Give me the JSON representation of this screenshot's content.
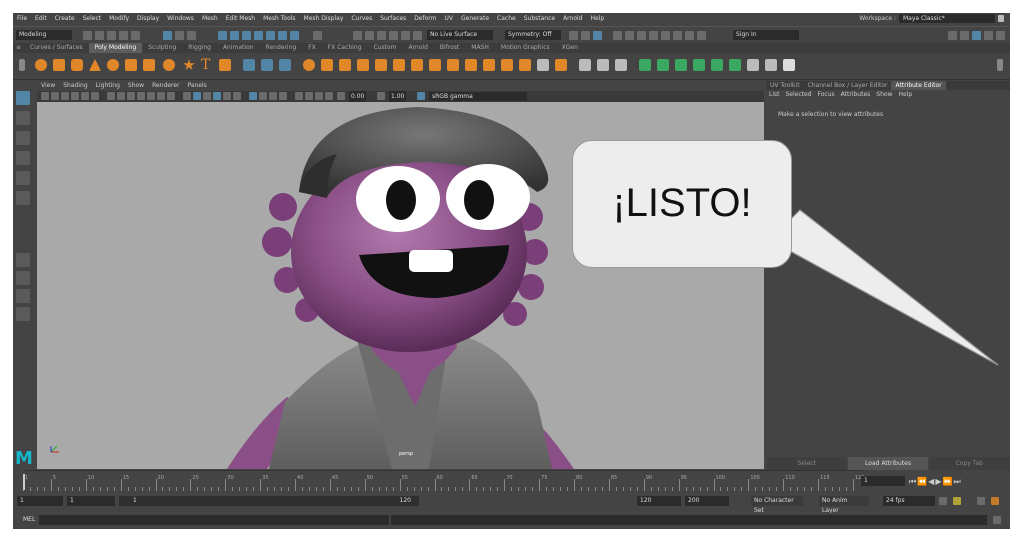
{
  "app": {
    "menu": [
      "File",
      "Edit",
      "Create",
      "Select",
      "Modify",
      "Display",
      "Windows",
      "Mesh",
      "Edit Mesh",
      "Mesh Tools",
      "Mesh Display",
      "Curves",
      "Surfaces",
      "Deform",
      "UV",
      "Generate",
      "Cache",
      "Substance",
      "Arnold",
      "Help"
    ],
    "workspace_label": "Workspace :",
    "workspace_value": "Maya Classic*"
  },
  "statusline": {
    "mode": "Modeling",
    "live_surface": "No Live Surface",
    "symmetry": "Symmetry: Off",
    "sign_in": "Sign In"
  },
  "shelf": {
    "tabs": [
      "Curves / Surfaces",
      "Poly Modeling",
      "Sculpting",
      "Rigging",
      "Animation",
      "Rendering",
      "FX",
      "FX Caching",
      "Custom",
      "Arnold",
      "Bifrost",
      "MASH",
      "Motion Graphics",
      "XGen"
    ],
    "active_tab": "Poly Modeling"
  },
  "viewport": {
    "menu": [
      "View",
      "Shading",
      "Lighting",
      "Show",
      "Renderer",
      "Panels"
    ],
    "exposure": "0.00",
    "gamma": "1.00",
    "color_space": "sRGB gamma",
    "camera_label": "persp"
  },
  "right_panel": {
    "tabs": [
      "UV Toolkit",
      "Channel Box / Layer Editor",
      "Attribute Editor"
    ],
    "active_tab": "Attribute Editor",
    "menu": [
      "List",
      "Selected",
      "Focus",
      "Attributes",
      "Show",
      "Help"
    ],
    "message": "Make a selection to view attributes",
    "buttons": [
      "Select",
      "Load Attributes",
      "Copy Tab"
    ]
  },
  "timeline": {
    "ticks": [
      "1",
      "5",
      "10",
      "15",
      "20",
      "25",
      "30",
      "35",
      "40",
      "45",
      "50",
      "55",
      "60",
      "65",
      "70",
      "75",
      "80",
      "85",
      "90",
      "95",
      "100",
      "105",
      "110",
      "115",
      "120"
    ],
    "current_frame": "1"
  },
  "range": {
    "start": "1",
    "playback_start": "1",
    "range_slider_start": "1",
    "range_slider_end": "120",
    "playback_end": "120",
    "end": "200",
    "character_set": "No Character Set",
    "anim_layer": "No Anim Layer",
    "fps": "24 fps"
  },
  "command_line": {
    "lang": "MEL"
  },
  "bubble": {
    "text": "¡LISTO!"
  },
  "colors": {
    "ui_bg": "#444444",
    "viewport_bg": "#a9a9a9",
    "character_purple": "#8a4f86",
    "accent_blue": "#5285a6"
  }
}
